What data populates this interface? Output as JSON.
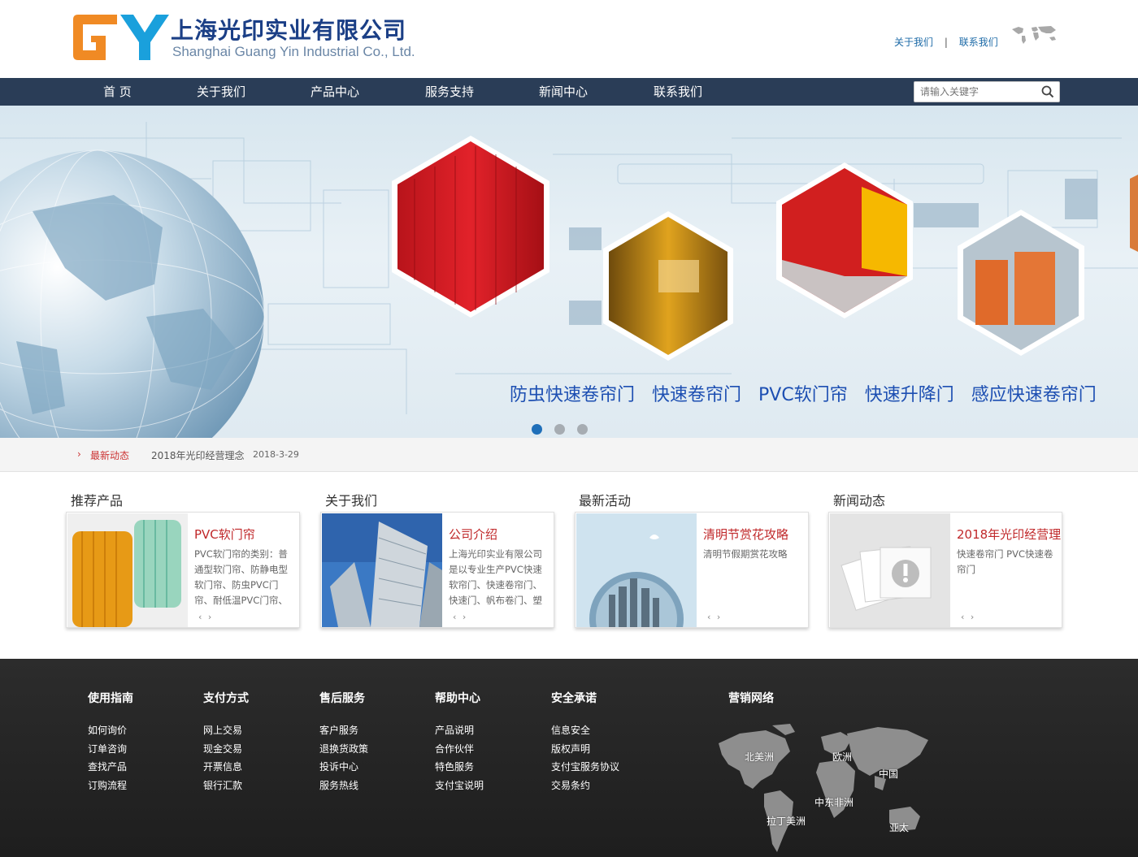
{
  "header": {
    "logo_cn": "上海光印实业有限公司",
    "logo_en": "Shanghai Guang Yin Industrial Co., Ltd.",
    "top_links": [
      "关于我们",
      "联系我们"
    ],
    "top_sep": "|"
  },
  "nav": {
    "items": [
      "首 页",
      "关于我们",
      "产品中心",
      "服务支持",
      "新闻中心",
      "联系我们"
    ],
    "search_placeholder": "请输入关键字"
  },
  "banner": {
    "tags": [
      "防虫快速卷帘门",
      "快速卷帘门",
      "PVC软门帘",
      "快速升降门",
      "感应快速卷帘门"
    ],
    "dots_count": 3,
    "active_dot": 0
  },
  "ticker": {
    "chevron": "›",
    "label": "最新动态",
    "text": "2018年光印经营理念",
    "date": "2018-3-29"
  },
  "sections": [
    {
      "heading": "推荐产品",
      "title": "PVC软门帘",
      "desc": "PVC软门帘的类别：普通型软门帘、防静电型软门帘、防虫PVC门帘、耐低温PVC门帘、",
      "arrows": "‹ ›"
    },
    {
      "heading": "关于我们",
      "title": "公司介绍",
      "desc": "上海光印实业有限公司是以专业生产PVC快速软帘门、快速卷帘门、快速门、帆布卷门、塑",
      "arrows": "‹ ›"
    },
    {
      "heading": "最新活动",
      "title": "清明节赏花攻略",
      "desc": "清明节假期赏花攻略",
      "arrows": "‹ ›"
    },
    {
      "heading": "新闻动态",
      "title": "2018年光印经营理",
      "desc": "快速卷帘门 PVC快速卷帘门",
      "arrows": "‹ ›"
    }
  ],
  "footer": {
    "columns": [
      {
        "title": "使用指南",
        "links": [
          "如何询价",
          "订单咨询",
          "查找产品",
          "订购流程"
        ]
      },
      {
        "title": "支付方式",
        "links": [
          "网上交易",
          "现金交易",
          "开票信息",
          "银行汇款"
        ]
      },
      {
        "title": "售后服务",
        "links": [
          "客户服务",
          "退换货政策",
          "投诉中心",
          "服务热线"
        ]
      },
      {
        "title": "帮助中心",
        "links": [
          "产品说明",
          "合作伙伴",
          "特色服务",
          "支付宝说明"
        ]
      },
      {
        "title": "安全承诺",
        "links": [
          "信息安全",
          "版权声明",
          "支付宝服务协议",
          "交易条约"
        ]
      }
    ],
    "network_title": "营销网络",
    "regions": [
      "北美洲",
      "欧洲",
      "中国",
      "中东非洲",
      "拉丁美洲",
      "亚太"
    ]
  },
  "colors": {
    "nav_bg": "#2a3d57",
    "accent_red": "#c0282a",
    "brand_blue": "#1b3f86",
    "logo_orange": "#f08a24",
    "logo_blue": "#1aa0dc"
  }
}
